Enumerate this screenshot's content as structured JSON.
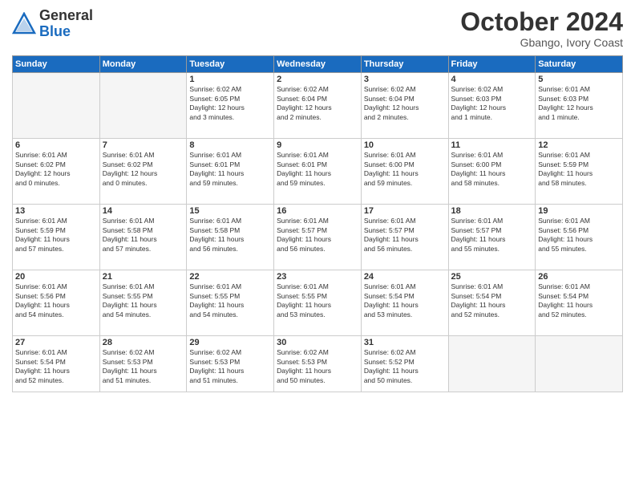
{
  "header": {
    "logo_general": "General",
    "logo_blue": "Blue",
    "month_title": "October 2024",
    "location": "Gbango, Ivory Coast"
  },
  "weekdays": [
    "Sunday",
    "Monday",
    "Tuesday",
    "Wednesday",
    "Thursday",
    "Friday",
    "Saturday"
  ],
  "weeks": [
    [
      {
        "day": "",
        "detail": ""
      },
      {
        "day": "",
        "detail": ""
      },
      {
        "day": "1",
        "detail": "Sunrise: 6:02 AM\nSunset: 6:05 PM\nDaylight: 12 hours\nand 3 minutes."
      },
      {
        "day": "2",
        "detail": "Sunrise: 6:02 AM\nSunset: 6:04 PM\nDaylight: 12 hours\nand 2 minutes."
      },
      {
        "day": "3",
        "detail": "Sunrise: 6:02 AM\nSunset: 6:04 PM\nDaylight: 12 hours\nand 2 minutes."
      },
      {
        "day": "4",
        "detail": "Sunrise: 6:02 AM\nSunset: 6:03 PM\nDaylight: 12 hours\nand 1 minute."
      },
      {
        "day": "5",
        "detail": "Sunrise: 6:01 AM\nSunset: 6:03 PM\nDaylight: 12 hours\nand 1 minute."
      }
    ],
    [
      {
        "day": "6",
        "detail": "Sunrise: 6:01 AM\nSunset: 6:02 PM\nDaylight: 12 hours\nand 0 minutes."
      },
      {
        "day": "7",
        "detail": "Sunrise: 6:01 AM\nSunset: 6:02 PM\nDaylight: 12 hours\nand 0 minutes."
      },
      {
        "day": "8",
        "detail": "Sunrise: 6:01 AM\nSunset: 6:01 PM\nDaylight: 11 hours\nand 59 minutes."
      },
      {
        "day": "9",
        "detail": "Sunrise: 6:01 AM\nSunset: 6:01 PM\nDaylight: 11 hours\nand 59 minutes."
      },
      {
        "day": "10",
        "detail": "Sunrise: 6:01 AM\nSunset: 6:00 PM\nDaylight: 11 hours\nand 59 minutes."
      },
      {
        "day": "11",
        "detail": "Sunrise: 6:01 AM\nSunset: 6:00 PM\nDaylight: 11 hours\nand 58 minutes."
      },
      {
        "day": "12",
        "detail": "Sunrise: 6:01 AM\nSunset: 5:59 PM\nDaylight: 11 hours\nand 58 minutes."
      }
    ],
    [
      {
        "day": "13",
        "detail": "Sunrise: 6:01 AM\nSunset: 5:59 PM\nDaylight: 11 hours\nand 57 minutes."
      },
      {
        "day": "14",
        "detail": "Sunrise: 6:01 AM\nSunset: 5:58 PM\nDaylight: 11 hours\nand 57 minutes."
      },
      {
        "day": "15",
        "detail": "Sunrise: 6:01 AM\nSunset: 5:58 PM\nDaylight: 11 hours\nand 56 minutes."
      },
      {
        "day": "16",
        "detail": "Sunrise: 6:01 AM\nSunset: 5:57 PM\nDaylight: 11 hours\nand 56 minutes."
      },
      {
        "day": "17",
        "detail": "Sunrise: 6:01 AM\nSunset: 5:57 PM\nDaylight: 11 hours\nand 56 minutes."
      },
      {
        "day": "18",
        "detail": "Sunrise: 6:01 AM\nSunset: 5:57 PM\nDaylight: 11 hours\nand 55 minutes."
      },
      {
        "day": "19",
        "detail": "Sunrise: 6:01 AM\nSunset: 5:56 PM\nDaylight: 11 hours\nand 55 minutes."
      }
    ],
    [
      {
        "day": "20",
        "detail": "Sunrise: 6:01 AM\nSunset: 5:56 PM\nDaylight: 11 hours\nand 54 minutes."
      },
      {
        "day": "21",
        "detail": "Sunrise: 6:01 AM\nSunset: 5:55 PM\nDaylight: 11 hours\nand 54 minutes."
      },
      {
        "day": "22",
        "detail": "Sunrise: 6:01 AM\nSunset: 5:55 PM\nDaylight: 11 hours\nand 54 minutes."
      },
      {
        "day": "23",
        "detail": "Sunrise: 6:01 AM\nSunset: 5:55 PM\nDaylight: 11 hours\nand 53 minutes."
      },
      {
        "day": "24",
        "detail": "Sunrise: 6:01 AM\nSunset: 5:54 PM\nDaylight: 11 hours\nand 53 minutes."
      },
      {
        "day": "25",
        "detail": "Sunrise: 6:01 AM\nSunset: 5:54 PM\nDaylight: 11 hours\nand 52 minutes."
      },
      {
        "day": "26",
        "detail": "Sunrise: 6:01 AM\nSunset: 5:54 PM\nDaylight: 11 hours\nand 52 minutes."
      }
    ],
    [
      {
        "day": "27",
        "detail": "Sunrise: 6:01 AM\nSunset: 5:54 PM\nDaylight: 11 hours\nand 52 minutes."
      },
      {
        "day": "28",
        "detail": "Sunrise: 6:02 AM\nSunset: 5:53 PM\nDaylight: 11 hours\nand 51 minutes."
      },
      {
        "day": "29",
        "detail": "Sunrise: 6:02 AM\nSunset: 5:53 PM\nDaylight: 11 hours\nand 51 minutes."
      },
      {
        "day": "30",
        "detail": "Sunrise: 6:02 AM\nSunset: 5:53 PM\nDaylight: 11 hours\nand 50 minutes."
      },
      {
        "day": "31",
        "detail": "Sunrise: 6:02 AM\nSunset: 5:52 PM\nDaylight: 11 hours\nand 50 minutes."
      },
      {
        "day": "",
        "detail": ""
      },
      {
        "day": "",
        "detail": ""
      }
    ]
  ]
}
